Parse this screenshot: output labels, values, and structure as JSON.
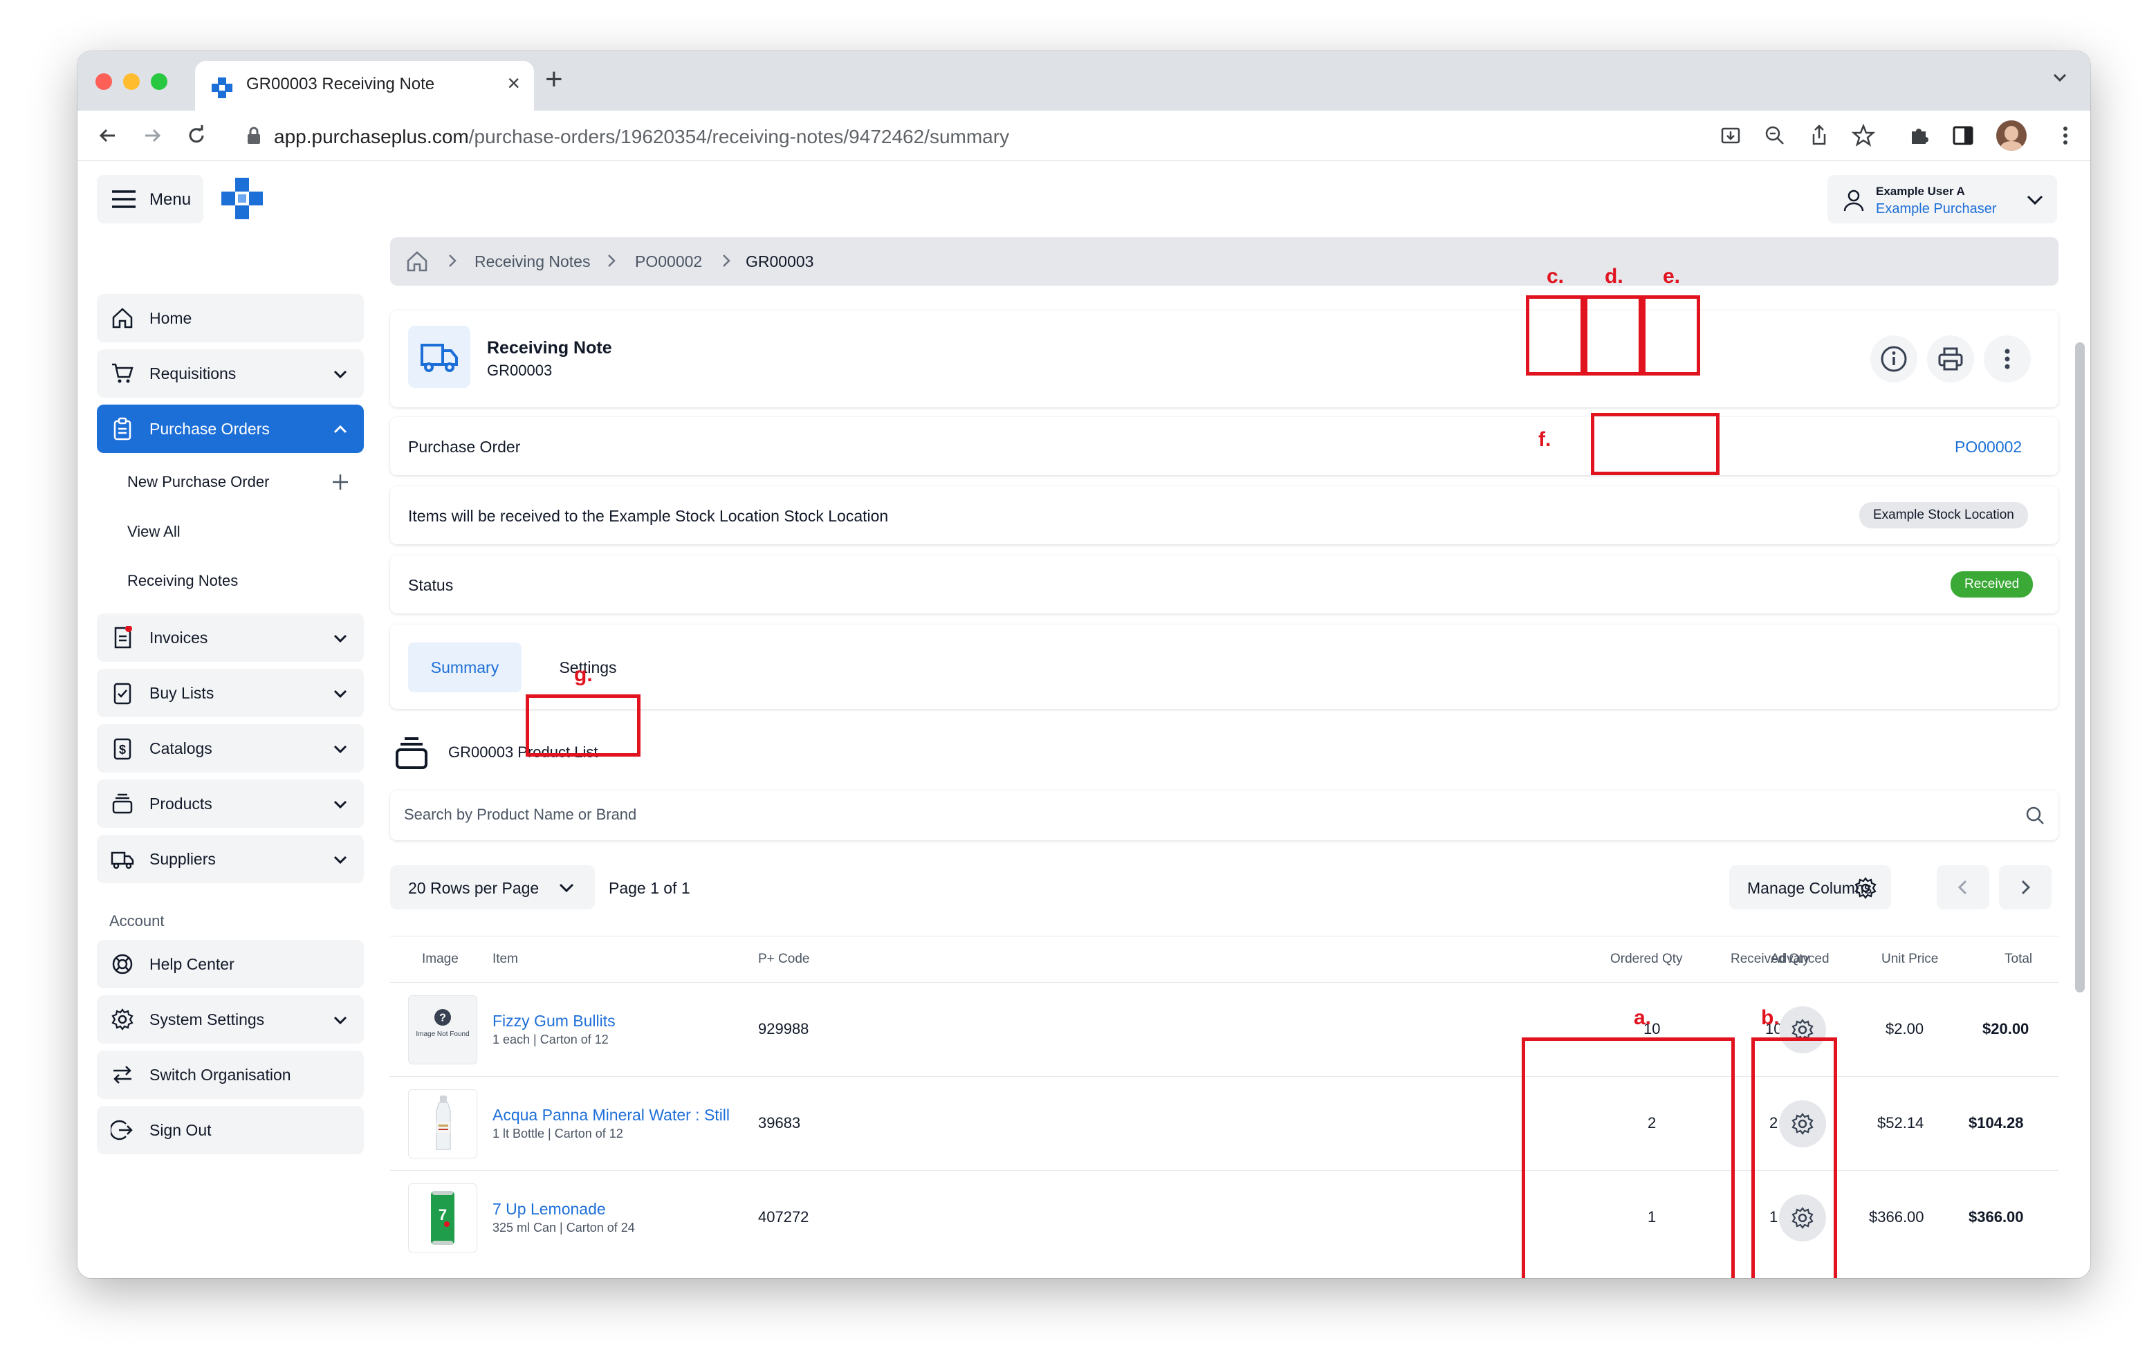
{
  "browser": {
    "tab_title": "GR00003 Receiving Note",
    "url_host": "app.purchaseplus.com",
    "url_path": "/purchase-orders/19620354/receiving-notes/9472462/summary"
  },
  "header": {
    "menu_label": "Menu",
    "user_name": "Example User A",
    "user_role": "Example Purchaser"
  },
  "sidebar": {
    "home": "Home",
    "requisitions": "Requisitions",
    "purchase_orders": "Purchase Orders",
    "po_sub": [
      "New Purchase Order",
      "View All",
      "Receiving Notes"
    ],
    "invoices": "Invoices",
    "buy_lists": "Buy Lists",
    "catalogs": "Catalogs",
    "products": "Products",
    "suppliers": "Suppliers",
    "account_heading": "Account",
    "help_center": "Help Center",
    "system_settings": "System Settings",
    "switch_org": "Switch Organisation",
    "sign_out": "Sign Out"
  },
  "breadcrumb": [
    "Receiving Notes",
    "PO00002",
    "GR00003"
  ],
  "note": {
    "title": "Receiving Note",
    "number": "GR00003",
    "po_label": "Purchase Order",
    "po_link": "PO00002",
    "location_text": "Items will be received to the Example Stock Location Stock Location",
    "location_badge": "Example Stock Location",
    "status_label": "Status",
    "status_value": "Received"
  },
  "tabs": {
    "summary": "Summary",
    "settings": "Settings"
  },
  "product_list": {
    "title": "GR00003 Product List",
    "search_placeholder": "Search by Product Name or Brand",
    "rows_per_page": "20 Rows per Page",
    "page_info": "Page 1 of 1",
    "manage_columns": "Manage Columns",
    "columns": [
      "Image",
      "Item",
      "P+ Code",
      "Ordered Qty",
      "Received Qty",
      "Advanced",
      "Unit Price",
      "Total"
    ],
    "image_not_found": "Image Not Found",
    "items": [
      {
        "name": "Fizzy Gum Bullits",
        "desc": "1 each | Carton of 12",
        "code": "929988",
        "ordered": "10",
        "received": "10",
        "unit_price": "$2.00",
        "total": "$20.00"
      },
      {
        "name": "Acqua Panna Mineral Water : Still",
        "desc": "1 lt Bottle | Carton of 12",
        "code": "39683",
        "ordered": "2",
        "received": "2",
        "unit_price": "$52.14",
        "total": "$104.28"
      },
      {
        "name": "7 Up Lemonade",
        "desc": "325 ml Can | Carton of 24",
        "code": "407272",
        "ordered": "1",
        "received": "1",
        "unit_price": "$366.00",
        "total": "$366.00"
      }
    ]
  },
  "annotations": [
    "a.",
    "b.",
    "c.",
    "d.",
    "e.",
    "f.",
    "g."
  ],
  "colors": {
    "accent": "#1d6fd8",
    "success": "#3aa935",
    "annotation": "#e0131f"
  }
}
